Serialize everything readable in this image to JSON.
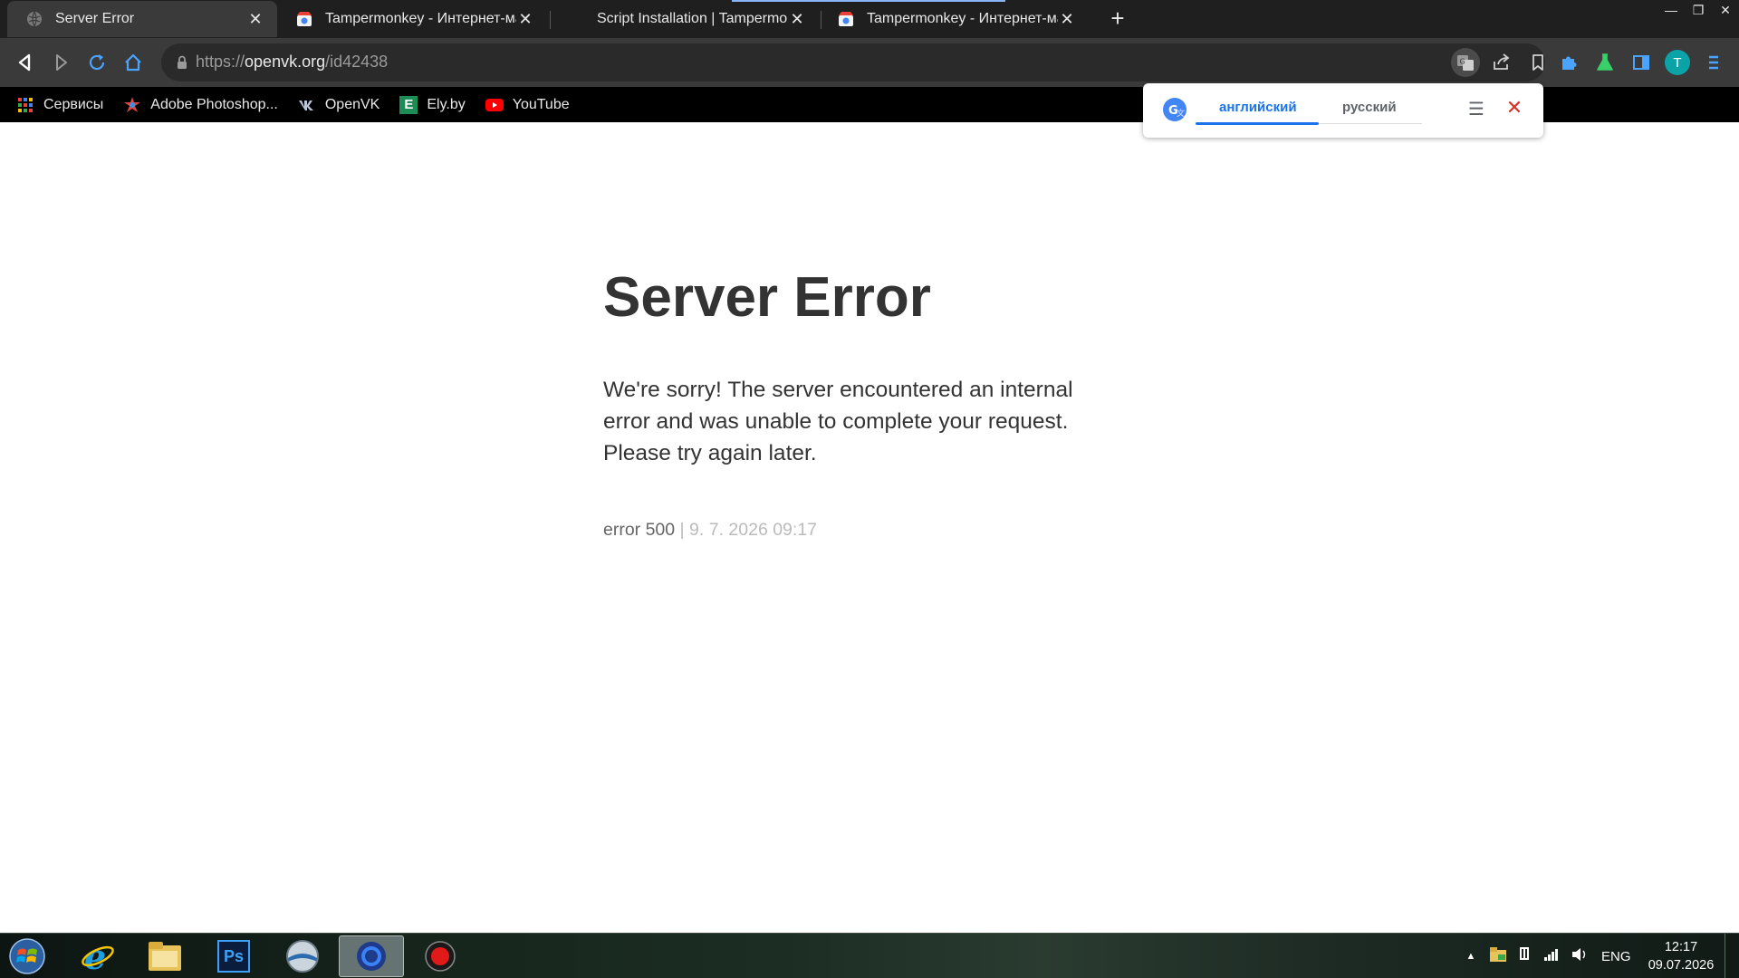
{
  "browser": {
    "tabs": [
      {
        "title": "Server Error",
        "active": true,
        "icon": "globe-icon"
      },
      {
        "title": "Tampermonkey - Интернет-магазин",
        "active": false,
        "icon": "chrome-webstore-icon"
      },
      {
        "title": "Script Installation | Tampermonkey",
        "active": false,
        "icon": "tampermonkey-icon"
      },
      {
        "title": "Tampermonkey - Интернет-магазин",
        "active": false,
        "icon": "chrome-webstore-icon"
      }
    ],
    "new_tab_label": "+",
    "address": {
      "scheme": "https://",
      "host": "openvk.org",
      "path": "/id42438"
    },
    "profile_initial": "T",
    "bookmarks": [
      {
        "label": "Сервисы",
        "icon": "apps-grid-icon"
      },
      {
        "label": "Adobe Photoshop...",
        "icon": "photoshop-bookmark-icon"
      },
      {
        "label": "OpenVK",
        "icon": "vk-icon"
      },
      {
        "label": "Ely.by",
        "icon": "ely-icon"
      },
      {
        "label": "YouTube",
        "icon": "youtube-icon"
      }
    ],
    "ely_letter": "E"
  },
  "translate": {
    "source_lang": "английский",
    "target_lang": "русский",
    "selected": "английский"
  },
  "page": {
    "title": "Server Error",
    "message": "We're sorry! The server encountered an internal error and was unable to complete your request. Please try again later.",
    "error_code": "error 500",
    "separator": "|",
    "timestamp": "9. 7. 2026 09:17"
  },
  "taskbar": {
    "apps": [
      "internet-explorer-icon",
      "file-explorer-icon",
      "photoshop-icon",
      "minecraft-launcher-icon",
      "chrome-icon",
      "recorder-icon"
    ],
    "ps_label": "Ps",
    "language": "ENG",
    "time": "12:17",
    "date": "09.07.2026"
  },
  "colors": {
    "tabstrip": "#1f1f1f",
    "toolbar": "#3a3a3a",
    "bookmarks_bar": "#000000",
    "accent_blue": "#1a73e8",
    "page_text": "#333333",
    "avatar": "#0aa3a8"
  }
}
